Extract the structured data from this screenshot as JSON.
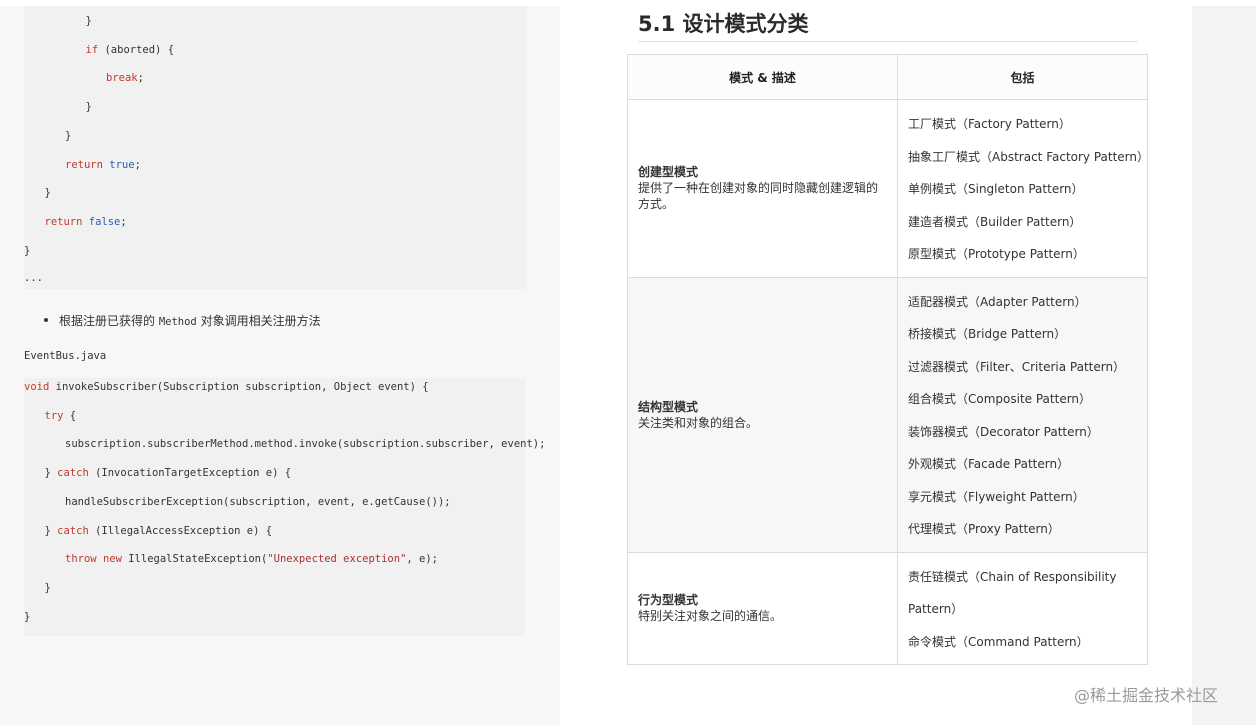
{
  "left_page": {
    "code_top_lines": [
      {
        "indent": 3,
        "parts": [
          {
            "t": "}",
            "c": ""
          }
        ]
      },
      {
        "indent": 3,
        "parts": [
          {
            "t": "if",
            "c": "kw"
          },
          {
            "t": " (aborted) {",
            "c": ""
          }
        ]
      },
      {
        "indent": 4,
        "parts": [
          {
            "t": "break",
            "c": "kw"
          },
          {
            "t": ";",
            "c": ""
          }
        ]
      },
      {
        "indent": 3,
        "parts": [
          {
            "t": "}",
            "c": ""
          }
        ]
      },
      {
        "indent": 2,
        "parts": [
          {
            "t": "}",
            "c": ""
          }
        ]
      },
      {
        "indent": 2,
        "parts": [
          {
            "t": "return",
            "c": "kw"
          },
          {
            "t": " ",
            "c": ""
          },
          {
            "t": "true",
            "c": "kb"
          },
          {
            "t": ";",
            "c": ""
          }
        ]
      },
      {
        "indent": 1,
        "parts": [
          {
            "t": "}",
            "c": ""
          }
        ]
      },
      {
        "indent": 1,
        "parts": [
          {
            "t": "return",
            "c": "kw"
          },
          {
            "t": " ",
            "c": ""
          },
          {
            "t": "false",
            "c": "kb"
          },
          {
            "t": ";",
            "c": ""
          }
        ]
      },
      {
        "indent": 0,
        "parts": [
          {
            "t": "}",
            "c": ""
          }
        ]
      }
    ],
    "ellipsis": "...",
    "bullet_before": "根据注册已获得的 ",
    "bullet_code": "Method",
    "bullet_after": " 对象调用相关注册方法",
    "filename": "EventBus.java",
    "code_bottom_lines": [
      {
        "indent": 0,
        "parts": [
          {
            "t": "void",
            "c": "kw"
          },
          {
            "t": " invokeSubscriber(Subscription subscription, Object event) {",
            "c": ""
          }
        ]
      },
      {
        "indent": 1,
        "parts": [
          {
            "t": "try",
            "c": "kw"
          },
          {
            "t": " {",
            "c": ""
          }
        ]
      },
      {
        "indent": 2,
        "parts": [
          {
            "t": "subscription.subscriberMethod.method.invoke(subscription.subscriber, event);",
            "c": ""
          }
        ]
      },
      {
        "indent": 1,
        "parts": [
          {
            "t": "} ",
            "c": ""
          },
          {
            "t": "catch",
            "c": "kw"
          },
          {
            "t": " (InvocationTargetException e) {",
            "c": ""
          }
        ]
      },
      {
        "indent": 2,
        "parts": [
          {
            "t": "handleSubscriberException(subscription, event, e.getCause());",
            "c": ""
          }
        ]
      },
      {
        "indent": 1,
        "parts": [
          {
            "t": "} ",
            "c": ""
          },
          {
            "t": "catch",
            "c": "kw"
          },
          {
            "t": " (IllegalAccessException e) {",
            "c": ""
          }
        ]
      },
      {
        "indent": 2,
        "parts": [
          {
            "t": "throw",
            "c": "kw"
          },
          {
            "t": " ",
            "c": ""
          },
          {
            "t": "new",
            "c": "kw"
          },
          {
            "t": " IllegalStateException(",
            "c": ""
          },
          {
            "t": "\"Unexpected exception\"",
            "c": "str"
          },
          {
            "t": ", e);",
            "c": ""
          }
        ]
      },
      {
        "indent": 1,
        "parts": [
          {
            "t": "}",
            "c": ""
          }
        ]
      },
      {
        "indent": 0,
        "parts": [
          {
            "t": "}",
            "c": ""
          }
        ]
      }
    ]
  },
  "right_page": {
    "section_title": "5.1  设计模式分类",
    "table": {
      "headers": [
        "模式 & 描述",
        "包括"
      ],
      "rows": [
        {
          "category": "创建型模式",
          "description": "提供了一种在创建对象的同时隐藏创建逻辑的方式。",
          "items": [
            "工厂模式（Factory Pattern）",
            "抽象工厂模式（Abstract Factory Pattern）",
            "单例模式（Singleton Pattern）",
            "建造者模式（Builder Pattern）",
            "原型模式（Prototype Pattern）"
          ]
        },
        {
          "category": "结构型模式",
          "description": "关注类和对象的组合。",
          "items": [
            "适配器模式（Adapter Pattern）",
            "桥接模式（Bridge Pattern）",
            "过滤器模式（Filter、Criteria Pattern）",
            "组合模式（Composite Pattern）",
            "装饰器模式（Decorator Pattern）",
            "外观模式（Facade Pattern）",
            "享元模式（Flyweight Pattern）",
            "代理模式（Proxy Pattern）"
          ]
        },
        {
          "category": "行为型模式",
          "description": "特别关注对象之间的通信。",
          "items": [
            "责任链模式（Chain of Responsibility Pattern）",
            "命令模式（Command Pattern）"
          ]
        }
      ]
    }
  },
  "watermark": "@稀土掘金技术社区"
}
